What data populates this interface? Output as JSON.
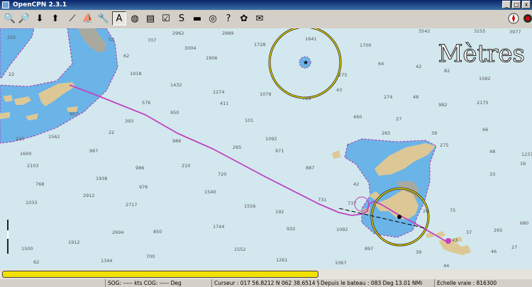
{
  "window": {
    "title": "OpenCPN 2.3.1",
    "controls": [
      "_",
      "□",
      "x"
    ]
  },
  "toolbar": {
    "buttons": [
      {
        "name": "zoom-in-icon",
        "glyph": "🔍"
      },
      {
        "name": "zoom-out-icon",
        "glyph": "🔎"
      },
      {
        "name": "scale-in-icon",
        "glyph": "⬇"
      },
      {
        "name": "scale-out-icon",
        "glyph": "⬆"
      },
      {
        "name": "route-icon",
        "glyph": "⟋"
      },
      {
        "name": "follow-ship-icon",
        "glyph": "⛵"
      },
      {
        "name": "settings-icon",
        "glyph": "🔧"
      },
      {
        "name": "text-icon",
        "glyph": "A"
      },
      {
        "name": "current-icon",
        "glyph": "◍"
      },
      {
        "name": "tide-icon",
        "glyph": "▤"
      },
      {
        "name": "route-manager-icon",
        "glyph": "☑"
      },
      {
        "name": "track-icon",
        "glyph": "S"
      },
      {
        "name": "color-scheme-icon",
        "glyph": "▬"
      },
      {
        "name": "mob-icon",
        "glyph": "◎"
      },
      {
        "name": "help-icon",
        "glyph": "?"
      },
      {
        "name": "plugin-icon",
        "glyph": "✿"
      },
      {
        "name": "print-icon",
        "glyph": "✉"
      }
    ],
    "compass_icon": "compass-icon",
    "gps_icon": "gps-status-icon"
  },
  "chart": {
    "scale_units": "Mètres",
    "soundings": [
      [
        "255",
        10,
        15
      ],
      [
        "53",
        153,
        18
      ],
      [
        "707",
        208,
        19
      ],
      [
        "2962",
        243,
        9
      ],
      [
        "2889",
        313,
        9
      ],
      [
        "1728",
        358,
        25
      ],
      [
        "1641",
        430,
        17
      ],
      [
        "1700",
        507,
        26
      ],
      [
        "3542",
        590,
        6
      ],
      [
        "3255",
        668,
        6
      ],
      [
        "3977",
        718,
        7
      ],
      [
        "62",
        174,
        41
      ],
      [
        "3004",
        260,
        30
      ],
      [
        "1906",
        290,
        44
      ],
      [
        "64",
        533,
        52
      ],
      [
        "42",
        586,
        56
      ],
      [
        "82",
        626,
        62
      ],
      [
        "1582",
        675,
        73
      ],
      [
        "22",
        12,
        67
      ],
      [
        "1918",
        183,
        66
      ],
      [
        "1432",
        240,
        82
      ],
      [
        "275",
        477,
        68
      ],
      [
        "43",
        474,
        89
      ],
      [
        "1274",
        300,
        92
      ],
      [
        "1079",
        366,
        95
      ],
      [
        "719",
        426,
        101
      ],
      [
        "274",
        541,
        99
      ],
      [
        "48",
        582,
        99
      ],
      [
        "982",
        618,
        110
      ],
      [
        "2175",
        672,
        107
      ],
      [
        "576",
        200,
        107
      ],
      [
        "411",
        310,
        108
      ],
      [
        "950",
        240,
        121
      ],
      [
        "907",
        98,
        123
      ],
      [
        "460",
        498,
        127
      ],
      [
        "27",
        558,
        130
      ],
      [
        "393",
        176,
        133
      ],
      [
        "101",
        345,
        132
      ],
      [
        "66",
        680,
        145
      ],
      [
        "22",
        153,
        149
      ],
      [
        "265",
        538,
        150
      ],
      [
        "39",
        608,
        150
      ],
      [
        "225",
        22,
        158
      ],
      [
        "1562",
        68,
        155
      ],
      [
        "986",
        243,
        161
      ],
      [
        "1092",
        374,
        158
      ],
      [
        "275",
        620,
        167
      ],
      [
        "265",
        328,
        170
      ],
      [
        "971",
        388,
        175
      ],
      [
        "48",
        690,
        176
      ],
      [
        "1237",
        735,
        180
      ],
      [
        "1600",
        28,
        179
      ],
      [
        "967",
        126,
        175
      ],
      [
        "16",
        733,
        193
      ],
      [
        "2103",
        38,
        196
      ],
      [
        "986",
        191,
        199
      ],
      [
        "210",
        256,
        196
      ],
      [
        "887",
        431,
        199
      ],
      [
        "33",
        690,
        208
      ],
      [
        "1938",
        135,
        214
      ],
      [
        "720",
        307,
        208
      ],
      [
        "768",
        50,
        222
      ],
      [
        "976",
        196,
        226
      ],
      [
        "42",
        498,
        222
      ],
      [
        "2912",
        117,
        238
      ],
      [
        "1540",
        288,
        233
      ],
      [
        "731",
        448,
        244
      ],
      [
        "737",
        490,
        249
      ],
      [
        "1033",
        36,
        248
      ],
      [
        "2717",
        177,
        251
      ],
      [
        "1556",
        344,
        253
      ],
      [
        "192",
        388,
        261
      ],
      [
        "28",
        596,
        260
      ],
      [
        "75",
        634,
        259
      ],
      [
        "1744",
        300,
        282
      ],
      [
        "932",
        404,
        285
      ],
      [
        "1092",
        474,
        286
      ],
      [
        "37",
        657,
        290
      ],
      [
        "265",
        696,
        287
      ],
      [
        "680",
        733,
        277
      ],
      [
        "2694",
        158,
        290
      ],
      [
        "850",
        216,
        289
      ],
      [
        "43",
        637,
        301
      ],
      [
        "1912",
        96,
        304
      ],
      [
        "1500",
        30,
        313
      ],
      [
        "897",
        514,
        313
      ],
      [
        "1552",
        330,
        314
      ],
      [
        "39",
        586,
        318
      ],
      [
        "46",
        692,
        317
      ],
      [
        "27",
        721,
        311
      ],
      [
        "1344",
        142,
        330
      ],
      [
        "700",
        206,
        324
      ],
      [
        "1261",
        389,
        329
      ],
      [
        "1067",
        472,
        333
      ],
      [
        "44",
        625,
        337
      ],
      [
        "62",
        47,
        332
      ]
    ]
  },
  "statusbar": {
    "sog": "SOG: ----- kts  COG: ----- Deg",
    "cursor": "Curseur : 017 56.8212 N 062 38.6514 W",
    "from_ship": "Depuis le bateau : 083 Deg    13.01 NMi",
    "scale": "Echelle vraie :   816300"
  }
}
